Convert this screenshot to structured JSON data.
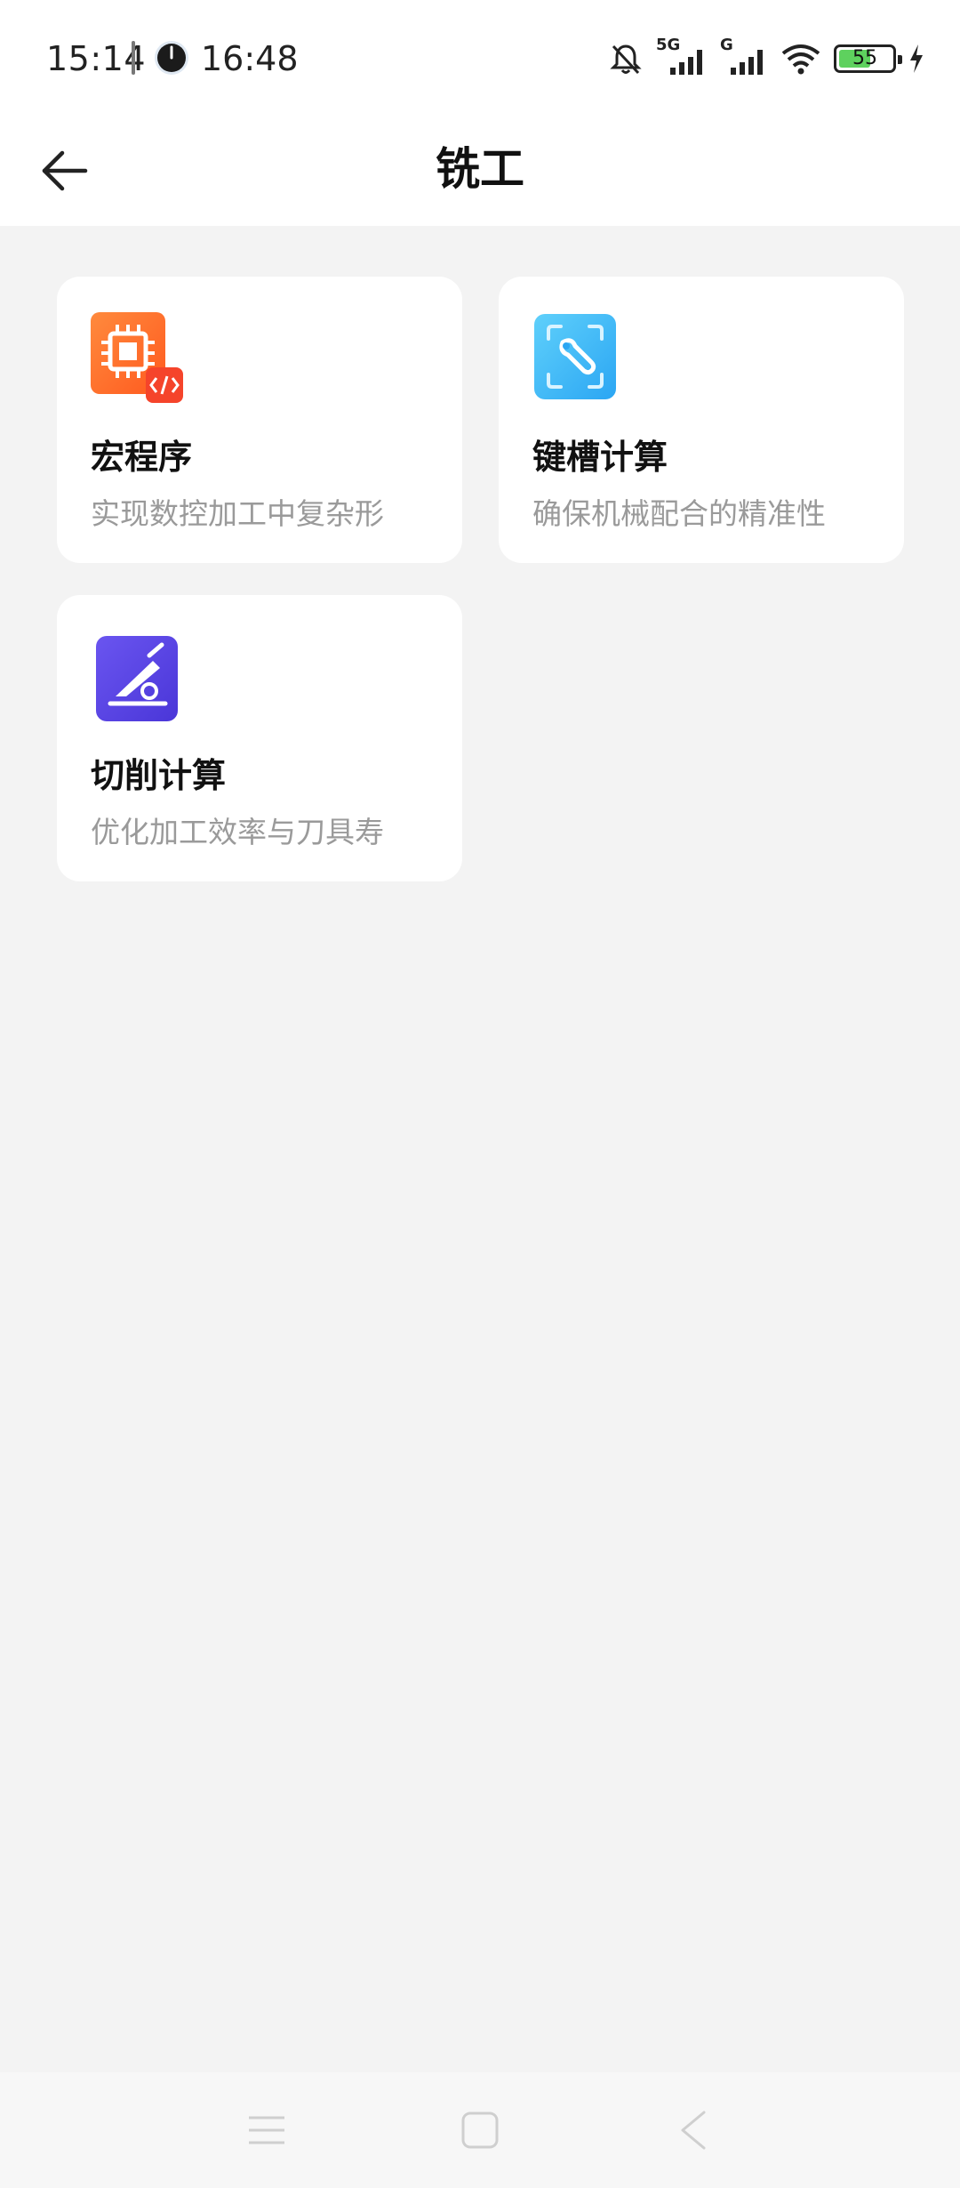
{
  "status_bar": {
    "time": "15:14",
    "secondary_time": "16:48",
    "network_5g": "5G",
    "network_g": "G",
    "battery_level": "55",
    "icons": [
      "mute-bell-icon",
      "signal-5g-icon",
      "signal-g-icon",
      "wifi-icon",
      "battery-icon",
      "charging-icon"
    ]
  },
  "header": {
    "title": "铣工",
    "back_icon": "arrow-left-icon"
  },
  "cards": [
    {
      "title": "宏程序",
      "desc": "实现数控加工中复杂形",
      "icon": "macro-chip-code-icon",
      "color": "#ff6a33"
    },
    {
      "title": "键槽计算",
      "desc": "确保机械配合的精准性",
      "icon": "wrench-scan-icon",
      "color": "#3fb8f7"
    },
    {
      "title": "切削计算",
      "desc": "优化加工效率与刀具寿",
      "icon": "cutting-tool-icon",
      "color": "#5b47e8"
    }
  ],
  "nav_bar": {
    "icons": [
      "menu-icon",
      "home-square-icon",
      "back-chevron-icon"
    ]
  }
}
